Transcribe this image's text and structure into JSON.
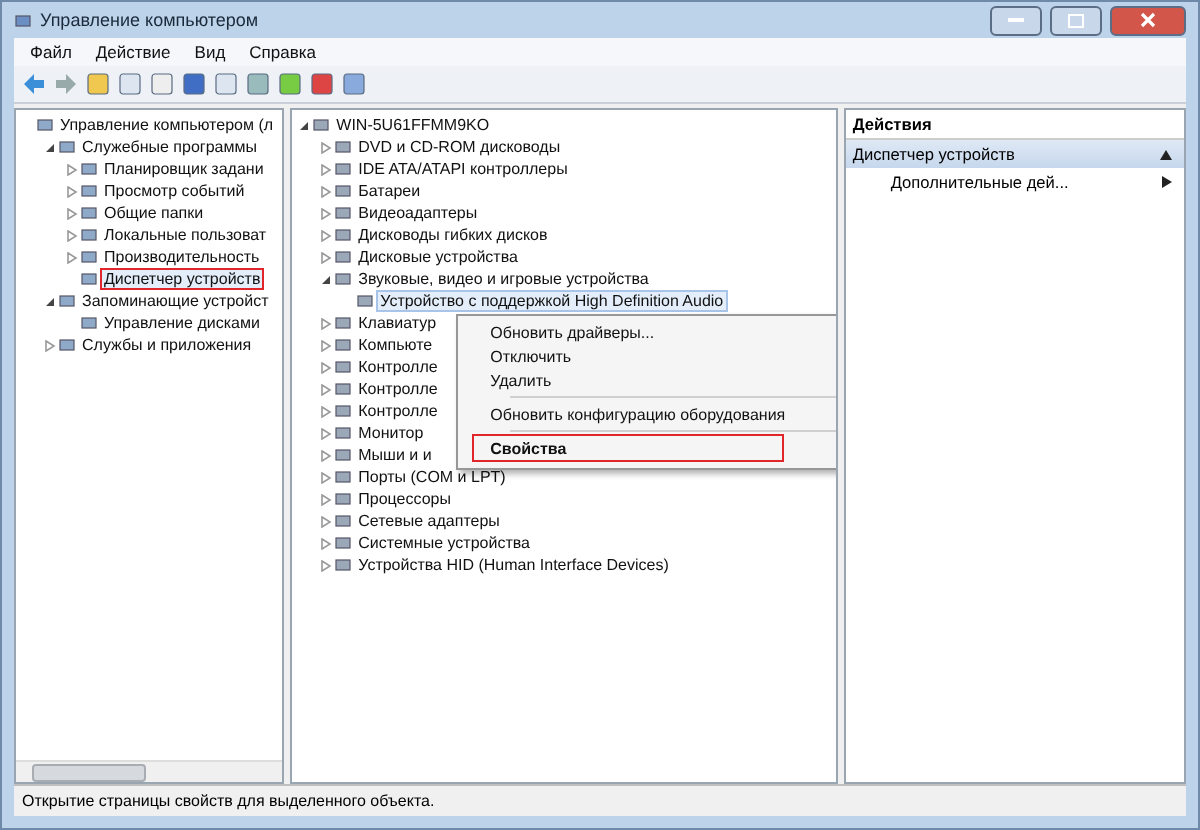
{
  "window": {
    "title": "Управление компьютером"
  },
  "menu": [
    "Файл",
    "Действие",
    "Вид",
    "Справка"
  ],
  "left_tree": [
    {
      "label": "Управление компьютером (л",
      "children": [
        {
          "label": "Служебные программы",
          "expanded": true,
          "children": [
            {
              "label": "Планировщик задани",
              "expanded": false
            },
            {
              "label": "Просмотр событий",
              "expanded": false
            },
            {
              "label": "Общие папки",
              "expanded": false
            },
            {
              "label": "Локальные пользоват",
              "expanded": false
            },
            {
              "label": "Производительность",
              "expanded": false
            },
            {
              "label": "Диспетчер устройств",
              "selected": true,
              "highlighted": true
            }
          ]
        },
        {
          "label": "Запоминающие устройст",
          "expanded": true,
          "children": [
            {
              "label": "Управление дисками"
            }
          ]
        },
        {
          "label": "Службы и приложения",
          "expanded": false
        }
      ]
    }
  ],
  "center_tree": [
    {
      "label": "WIN-5U61FFMM9KO",
      "expanded": true,
      "children": [
        {
          "label": "DVD и CD-ROM дисководы",
          "expanded": false
        },
        {
          "label": "IDE ATA/ATAPI контроллеры",
          "expanded": false
        },
        {
          "label": "Батареи",
          "expanded": false
        },
        {
          "label": "Видеоадаптеры",
          "expanded": false
        },
        {
          "label": "Дисководы гибких дисков",
          "expanded": false
        },
        {
          "label": "Дисковые устройства",
          "expanded": false
        },
        {
          "label": "Звуковые, видео и игровые устройства",
          "expanded": true,
          "children": [
            {
              "label": "Устройство с поддержкой High Definition Audio",
              "selected": true
            }
          ]
        },
        {
          "label": "Клавиатур",
          "expanded": false
        },
        {
          "label": "Компьюте",
          "expanded": false
        },
        {
          "label": "Контролле",
          "expanded": false
        },
        {
          "label": "Контролле",
          "expanded": false
        },
        {
          "label": "Контролле",
          "expanded": false
        },
        {
          "label": "Монитор",
          "expanded": false
        },
        {
          "label": "Мыши и и",
          "expanded": false
        },
        {
          "label": "Порты (COM и LPT)",
          "expanded": false
        },
        {
          "label": "Процессоры",
          "expanded": false
        },
        {
          "label": "Сетевые адаптеры",
          "expanded": false
        },
        {
          "label": "Системные устройства",
          "expanded": false
        },
        {
          "label": "Устройства HID (Human Interface Devices)",
          "expanded": false
        }
      ]
    }
  ],
  "context_menu": [
    {
      "kind": "item",
      "label": "Обновить драйверы...",
      "bold": false,
      "highlighted": false
    },
    {
      "kind": "item",
      "label": "Отключить",
      "bold": false,
      "highlighted": false
    },
    {
      "kind": "item",
      "label": "Удалить",
      "bold": false,
      "highlighted": false
    },
    {
      "kind": "separator"
    },
    {
      "kind": "item",
      "label": "Обновить конфигурацию оборудования",
      "bold": false,
      "highlighted": false
    },
    {
      "kind": "separator"
    },
    {
      "kind": "item",
      "label": "Свойства",
      "bold": true,
      "highlighted": true
    }
  ],
  "actions": {
    "title": "Действия",
    "section": "Диспетчер устройств",
    "items": [
      "Дополнительные дей..."
    ]
  },
  "status_bar": "Открытие страницы свойств для выделенного объекта."
}
